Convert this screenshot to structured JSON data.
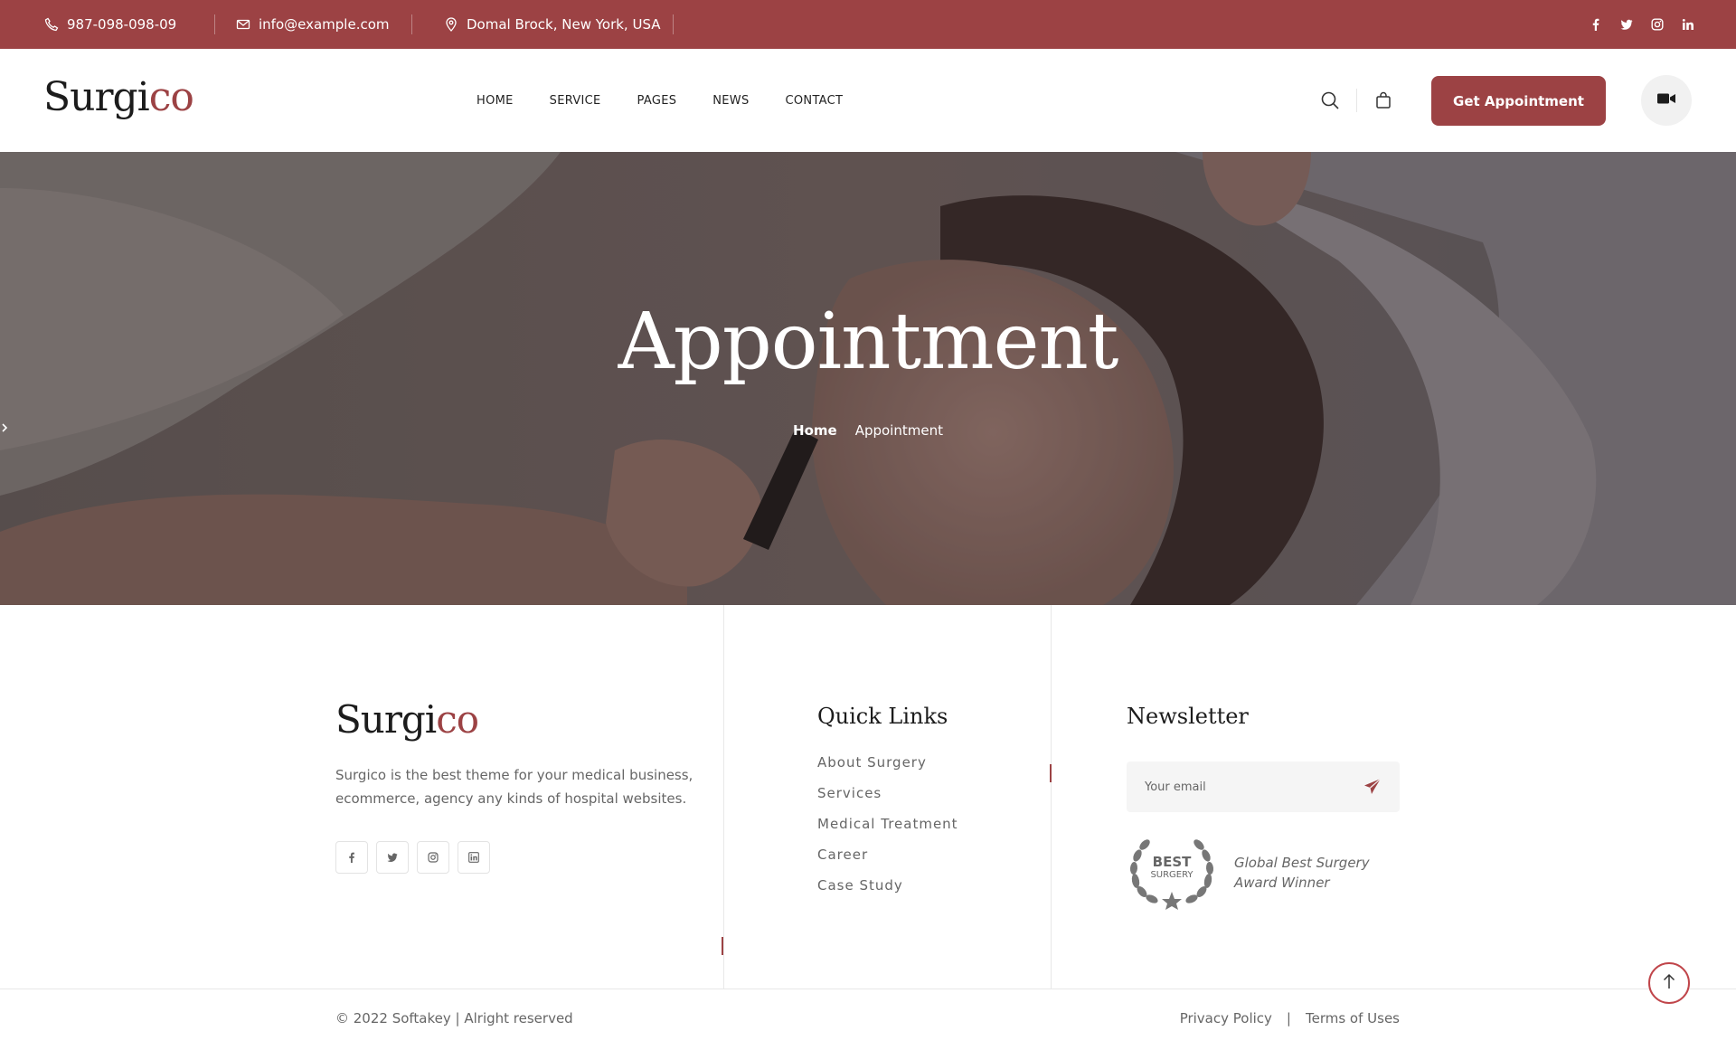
{
  "topbar": {
    "phone": "987-098-098-09",
    "email": "info@example.com",
    "address": "Domal Brock, New York, USA",
    "social": [
      "facebook-icon",
      "twitter-icon",
      "instagram-icon",
      "linkedin-icon"
    ]
  },
  "header": {
    "logo_main": "Surgi",
    "logo_accent": "co",
    "nav": [
      "HOME",
      "SERVICE",
      "PAGES",
      "NEWS",
      "CONTACT"
    ],
    "cta_label": "Get Appointment"
  },
  "hero": {
    "title": "Appointment",
    "breadcrumb_home": "Home",
    "breadcrumb_current": "Appointment"
  },
  "footer": {
    "logo_main": "Surgi",
    "logo_accent": "co",
    "description": "Surgico is the best theme for your medical business, ecommerce, agency any kinds of hospital websites.",
    "quick_links_title": "Quick Links",
    "quick_links": [
      "About Surgery",
      "Services",
      "Medical Treatment",
      "Career",
      "Case Study"
    ],
    "newsletter_title": "Newsletter",
    "newsletter_placeholder": "Your email",
    "award_badge_top": "BEST",
    "award_badge_bottom": "SURGERY",
    "award_line1": "Global Best Surgery",
    "award_line2": "Award Winner",
    "copyright": "© 2022 Softakey | Alright reserved",
    "privacy": "Privacy Policy",
    "separator": "|",
    "terms": "Terms of Uses"
  },
  "colors": {
    "brand": "#9c4244",
    "text": "#666666",
    "dark": "#1c1c1c"
  }
}
